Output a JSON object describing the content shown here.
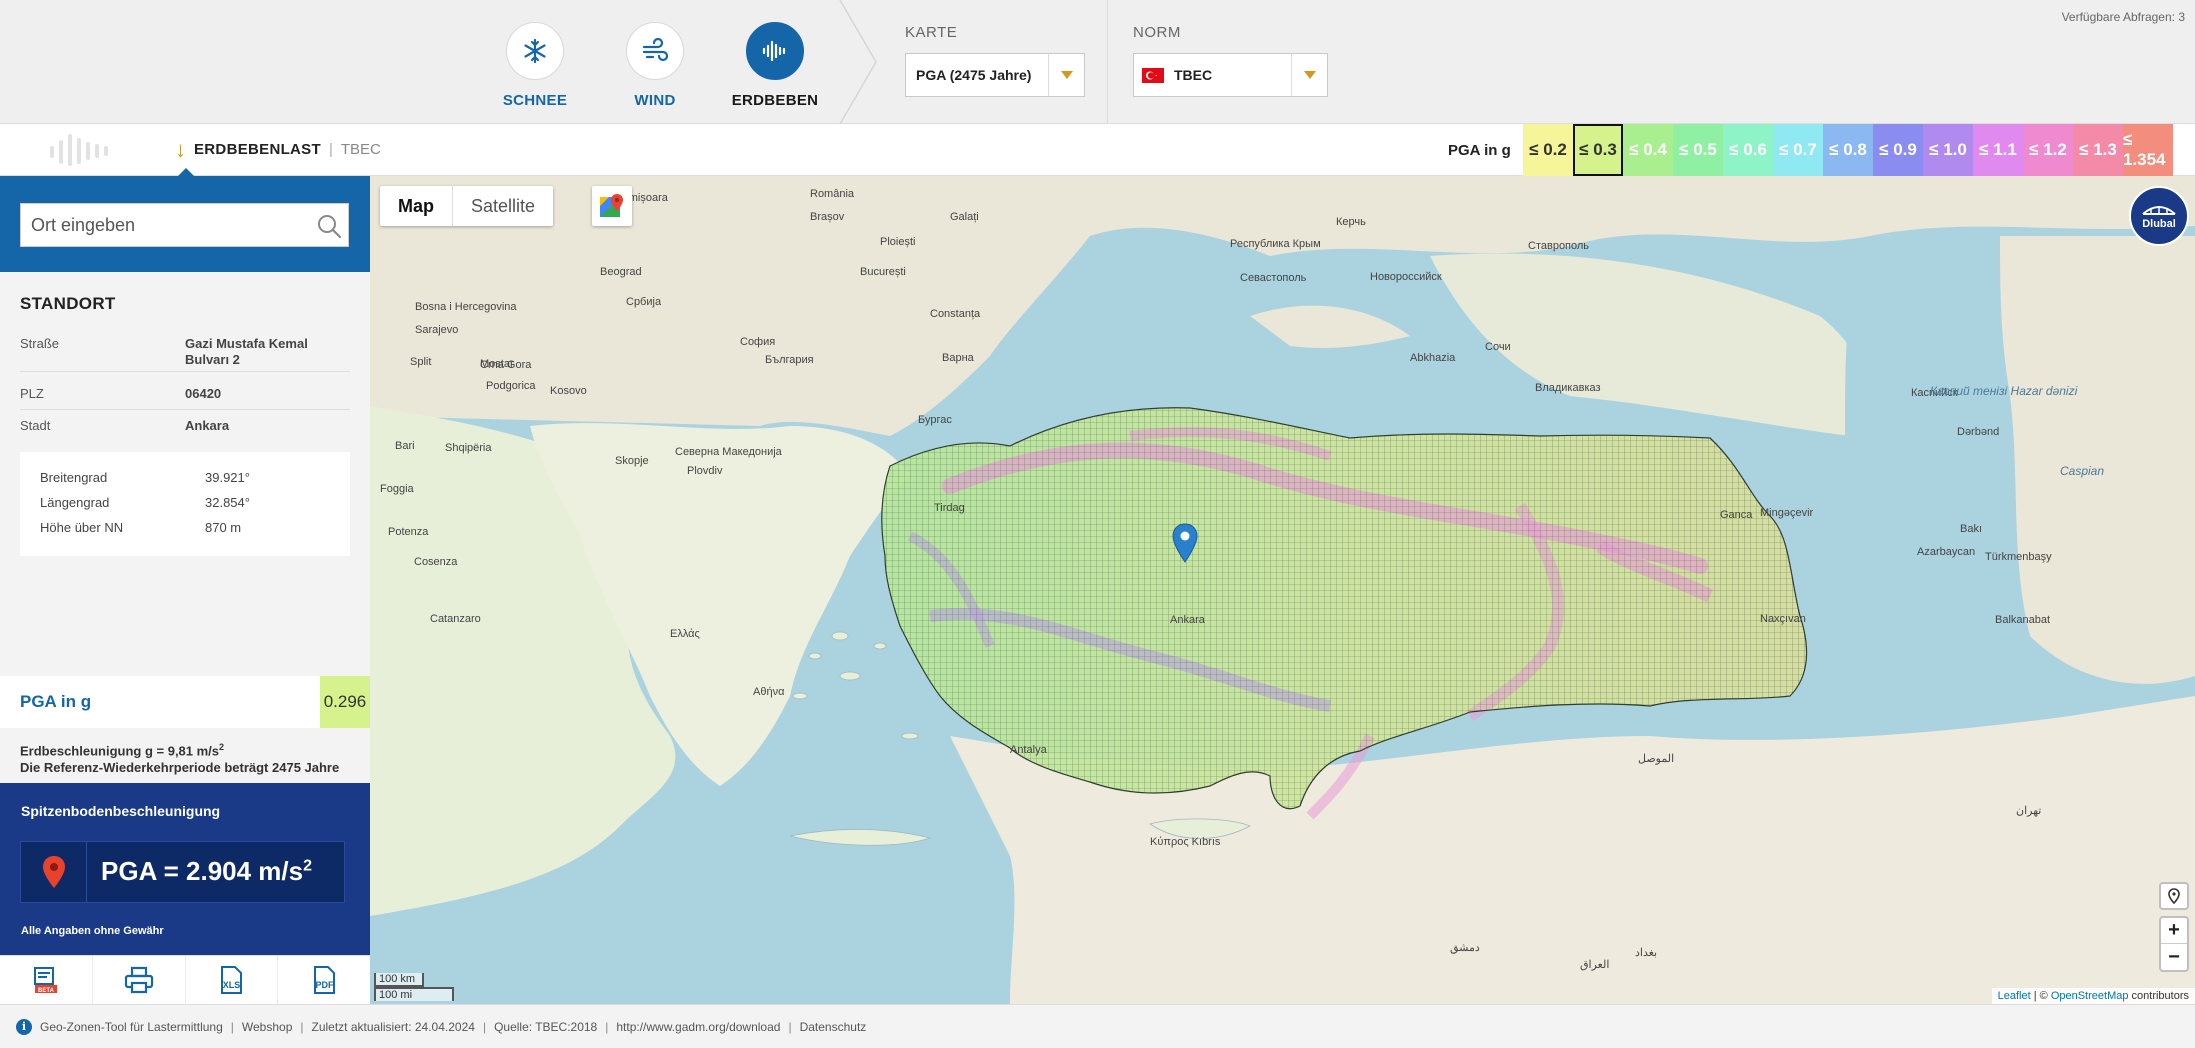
{
  "topbar": {
    "modes": [
      {
        "label": "SCHNEE",
        "icon": "snowflake-icon"
      },
      {
        "label": "WIND",
        "icon": "wind-icon"
      },
      {
        "label": "ERDBEBEN",
        "icon": "seismic-wave-icon"
      }
    ],
    "active_mode": "ERDBEBEN",
    "karte_label": "KARTE",
    "karte_value": "PGA (2475 Jahre)",
    "norm_label": "NORM",
    "norm_value": "TBEC",
    "available_queries": "Verfügbare Abfragen: 3"
  },
  "bar2": {
    "crumb_main": "ERDBEBENLAST",
    "crumb_sep": "|",
    "crumb_sub": "TBEC",
    "pga_label": "PGA in g",
    "legend": [
      {
        "label": "≤ 0.2",
        "color": "#f6f59a"
      },
      {
        "label": "≤ 0.3",
        "color": "#d5f28c"
      },
      {
        "label": "≤ 0.4",
        "color": "#a9ef8f"
      },
      {
        "label": "≤ 0.5",
        "color": "#8ff0a4"
      },
      {
        "label": "≤ 0.6",
        "color": "#8ef3c6"
      },
      {
        "label": "≤ 0.7",
        "color": "#90e8f2"
      },
      {
        "label": "≤ 0.8",
        "color": "#8bb8f0"
      },
      {
        "label": "≤ 0.9",
        "color": "#8a8cf0"
      },
      {
        "label": "≤ 1.0",
        "color": "#b18af0"
      },
      {
        "label": "≤ 1.1",
        "color": "#e08af0"
      },
      {
        "label": "≤ 1.2",
        "color": "#f08ad0"
      },
      {
        "label": "≤ 1.3",
        "color": "#f38aa8"
      },
      {
        "label": "≤ 1.354",
        "color": "#f38e7e"
      }
    ],
    "legend_selected": "≤ 0.3"
  },
  "sidebar": {
    "search_placeholder": "Ort eingeben",
    "standort_title": "STANDORT",
    "strasse_label": "Straße",
    "strasse_value_1": "Gazi Mustafa Kemal",
    "strasse_value_2": "Bulvarı 2",
    "plz_label": "PLZ",
    "plz_value": "06420",
    "stadt_label": "Stadt",
    "stadt_value": "Ankara",
    "lat_label": "Breitengrad",
    "lat_value": "39.921°",
    "lon_label": "Längengrad",
    "lon_value": "32.854°",
    "alt_label": "Höhe über NN",
    "alt_value": "870 m",
    "pga_label": "PGA in g",
    "pga_value": "0.296",
    "note_g": "Erdbeschleunigung g = 9,81 m/s",
    "note_g_sup": "2",
    "note_period": "Die Referenz-Wiederkehrperiode beträgt 2475 Jahre",
    "spitzen_title": "Spitzenbodenbeschleunigung",
    "spitzen_value": "PGA = 2.904 m/s",
    "spitzen_sup": "2",
    "disclaimer": "Alle Angaben ohne Gewähr",
    "tools": [
      {
        "name": "beta-report-button",
        "label": "BETA"
      },
      {
        "name": "print-button",
        "label": ""
      },
      {
        "name": "xls-export-button",
        "label": "XLS"
      },
      {
        "name": "pdf-export-button",
        "label": "PDF"
      }
    ]
  },
  "map": {
    "tab_map": "Map",
    "tab_satellite": "Satellite",
    "dlubal": "Dlubal",
    "zoom_in": "+",
    "zoom_out": "−",
    "scale_km": "100 km",
    "scale_mi": "100 mi",
    "attrib_leaflet": "Leaflet",
    "attrib_sep": " | © ",
    "attrib_osm": "OpenStreetMap",
    "attrib_contrib": " contributors",
    "labels": [
      {
        "t": "România",
        "sea": false
      },
      {
        "t": "Timișoara",
        "sea": false
      },
      {
        "t": "Brașov",
        "sea": false
      },
      {
        "t": "Galați",
        "sea": false
      },
      {
        "t": "Ploiești",
        "sea": false
      },
      {
        "t": "București",
        "sea": false
      },
      {
        "t": "Constanța",
        "sea": false
      },
      {
        "t": "Beograd",
        "sea": false
      },
      {
        "t": "Србија",
        "sea": false
      },
      {
        "t": "Bosna i Hercegovina",
        "sea": false
      },
      {
        "t": "Crna Gora",
        "sea": false
      },
      {
        "t": "Kosovo",
        "sea": false
      },
      {
        "t": "София",
        "sea": false
      },
      {
        "t": "България",
        "sea": false
      },
      {
        "t": "Варна",
        "sea": false
      },
      {
        "t": "Бургас",
        "sea": false
      },
      {
        "t": "Shqipëria",
        "sea": false
      },
      {
        "t": "Северна Македонија",
        "sea": false
      },
      {
        "t": "Ελλάς",
        "sea": false
      },
      {
        "t": "Αθήνα",
        "sea": false
      },
      {
        "t": "Tirdag",
        "sea": false
      },
      {
        "t": "Κύπρος Kıbrıs",
        "sea": false
      },
      {
        "t": "Севастополь",
        "sea": false
      },
      {
        "t": "Республика Крым",
        "sea": false
      },
      {
        "t": "Керчь",
        "sea": false
      },
      {
        "t": "Новороссийск",
        "sea": false
      },
      {
        "t": "Ставрополь",
        "sea": false
      },
      {
        "t": "Сочи",
        "sea": false
      },
      {
        "t": "Владикавказ",
        "sea": false
      },
      {
        "t": "Abkhazia",
        "sea": false
      },
      {
        "t": "Azarbaycan",
        "sea": false
      },
      {
        "t": "Bakı",
        "sea": false
      },
      {
        "t": "Dərbənd",
        "sea": false
      },
      {
        "t": "Каспийск",
        "sea": false
      },
      {
        "t": "Türkmenbaşy",
        "sea": false
      },
      {
        "t": "Balkanabat",
        "sea": false
      },
      {
        "t": "Ganca",
        "sea": false
      },
      {
        "t": "Mingəçevir",
        "sea": false
      },
      {
        "t": "Naxçıvan",
        "sea": false
      },
      {
        "t": "Ankara",
        "sea": false
      },
      {
        "t": "Antalya",
        "sea": false
      },
      {
        "t": "Bari",
        "sea": false
      },
      {
        "t": "Foggia",
        "sea": false
      },
      {
        "t": "Potenza",
        "sea": false
      },
      {
        "t": "Cosenza",
        "sea": false
      },
      {
        "t": "Catanzaro",
        "sea": false
      },
      {
        "t": "Sarajevo",
        "sea": false
      },
      {
        "t": "Split",
        "sea": false
      },
      {
        "t": "Mostar",
        "sea": false
      },
      {
        "t": "Podgorica",
        "sea": false
      },
      {
        "t": "Skopje",
        "sea": false
      },
      {
        "t": "Plovdiv",
        "sea": false
      },
      {
        "t": "دمشق",
        "sea": false
      },
      {
        "t": "العراق",
        "sea": false
      },
      {
        "t": "بغداد",
        "sea": false
      },
      {
        "t": "الموصل",
        "sea": false
      },
      {
        "t": "تهران",
        "sea": false
      },
      {
        "t": "Каспий тенізі Hazar dənizi",
        "sea": true
      },
      {
        "t": "Caspian",
        "sea": true
      }
    ]
  },
  "footer": {
    "items": [
      "Geo-Zonen-Tool für Lastermittlung",
      "Webshop",
      "Zuletzt aktualisiert: 24.04.2024",
      "Quelle: TBEC:2018",
      "http://www.gadm.org/download",
      "Datenschutz"
    ],
    "sep": "|"
  }
}
